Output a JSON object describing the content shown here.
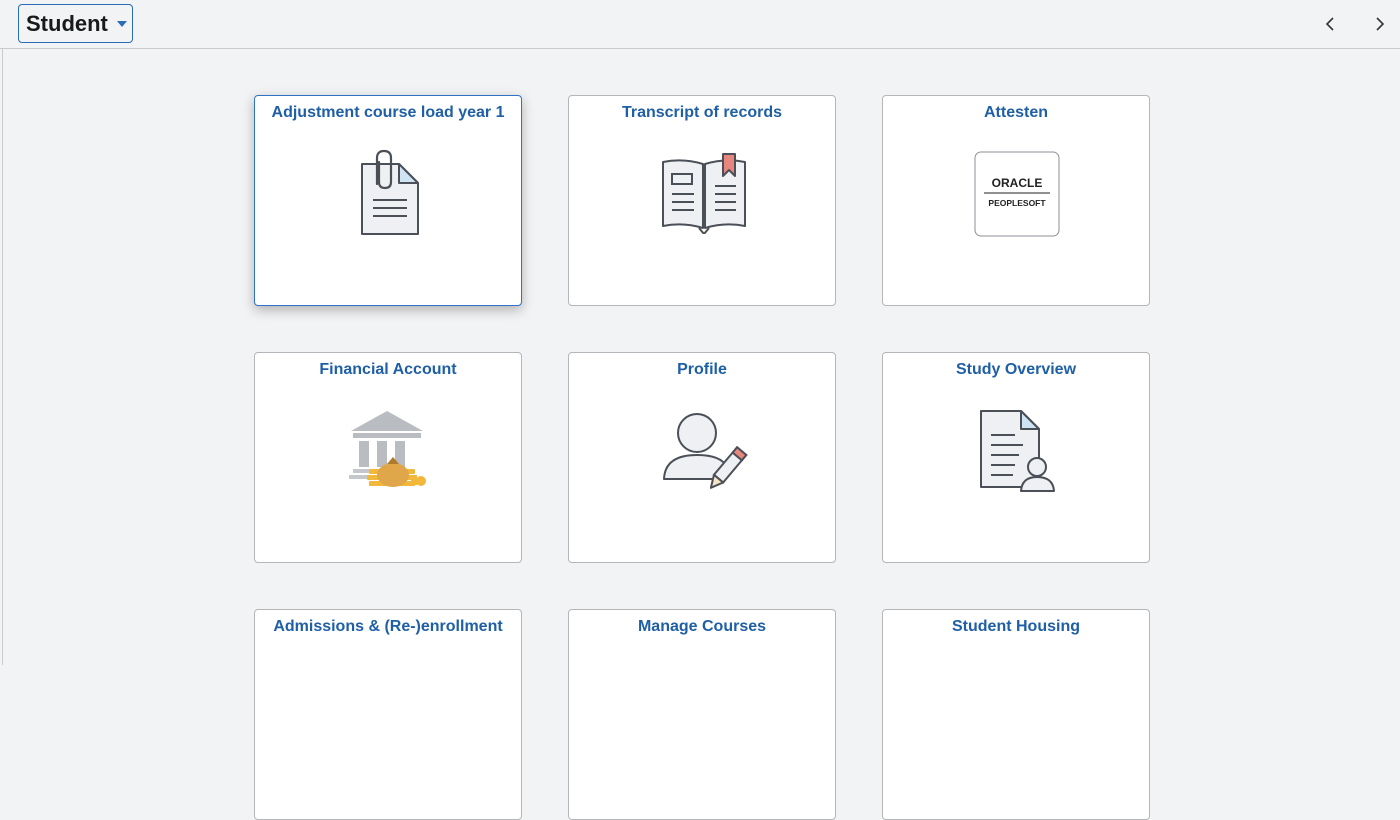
{
  "header": {
    "homepage_selector": "Student",
    "prev_icon": "chevron-left-icon",
    "next_icon": "chevron-right-icon"
  },
  "tiles": [
    {
      "title": "Adjustment course load year 1",
      "icon": "paperclip-document-icon"
    },
    {
      "title": "Transcript of records",
      "icon": "open-book-icon"
    },
    {
      "title": "Attesten",
      "icon": "oracle-peoplesoft-logo",
      "logo": {
        "line1": "ORACLE",
        "line2": "PEOPLESOFT"
      }
    },
    {
      "title": "Financial Account",
      "icon": "bank-money-icon"
    },
    {
      "title": "Profile",
      "icon": "user-edit-icon"
    },
    {
      "title": "Study Overview",
      "icon": "document-user-icon"
    },
    {
      "title": "Admissions & (Re-)enrollment",
      "icon": ""
    },
    {
      "title": "Manage Courses",
      "icon": ""
    },
    {
      "title": "Student Housing",
      "icon": ""
    }
  ],
  "colors": {
    "accent": "#1f5fa6",
    "focus_border": "#2f73c9",
    "background": "#f2f3f5",
    "bookmark": "#e8857c",
    "gold": "#f1b83c"
  }
}
